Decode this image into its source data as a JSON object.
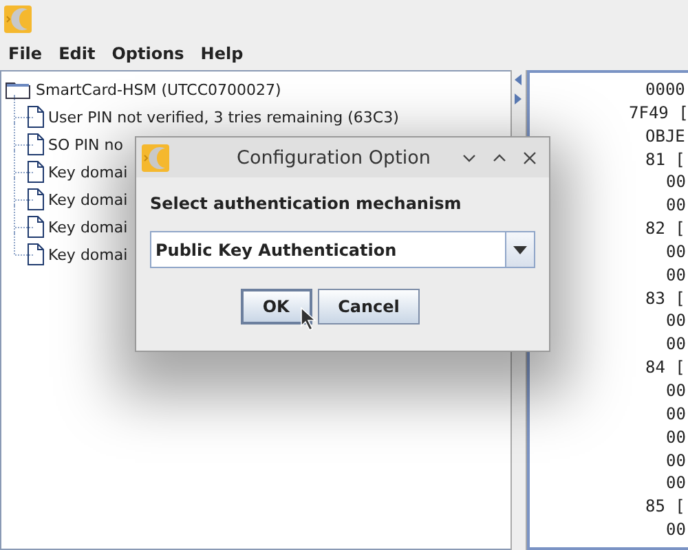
{
  "window": {
    "menu": [
      "File",
      "Edit",
      "Options",
      "Help"
    ]
  },
  "tree": {
    "label": "SmartCard-HSM (UTCC0700027)",
    "children": [
      {
        "label": "User PIN not verified, 3 tries remaining (63C3)"
      },
      {
        "label": "SO PIN no"
      },
      {
        "label": "Key domai"
      },
      {
        "label": "Key domai"
      },
      {
        "label": "Key domai"
      },
      {
        "label": "Key domai"
      }
    ]
  },
  "listing": [
    {
      "text": "0000",
      "kind": "offset"
    },
    {
      "text": "7F49 [",
      "kind": "tag"
    },
    {
      "text": "OBJE",
      "kind": "field"
    },
    {
      "text": "81 [",
      "kind": "field"
    },
    {
      "text": "00",
      "kind": "byte"
    },
    {
      "text": "00",
      "kind": "byte"
    },
    {
      "text": "82 [",
      "kind": "field"
    },
    {
      "text": "00",
      "kind": "byte"
    },
    {
      "text": "00",
      "kind": "byte"
    },
    {
      "text": "83 [",
      "kind": "field"
    },
    {
      "text": "00",
      "kind": "byte"
    },
    {
      "text": "00",
      "kind": "byte"
    },
    {
      "text": "84 [",
      "kind": "field"
    },
    {
      "text": "00",
      "kind": "byte"
    },
    {
      "text": "00",
      "kind": "byte"
    },
    {
      "text": "00",
      "kind": "byte"
    },
    {
      "text": "00",
      "kind": "byte"
    },
    {
      "text": "00",
      "kind": "byte"
    },
    {
      "text": "85 [",
      "kind": "field"
    },
    {
      "text": "00",
      "kind": "byte"
    }
  ],
  "dialog": {
    "title": "Configuration Option",
    "label": "Select authentication mechanism",
    "combo": {
      "value": "Public Key Authentication"
    },
    "buttons": [
      {
        "label": "OK",
        "focused": true
      },
      {
        "label": "Cancel",
        "focused": false
      }
    ]
  }
}
